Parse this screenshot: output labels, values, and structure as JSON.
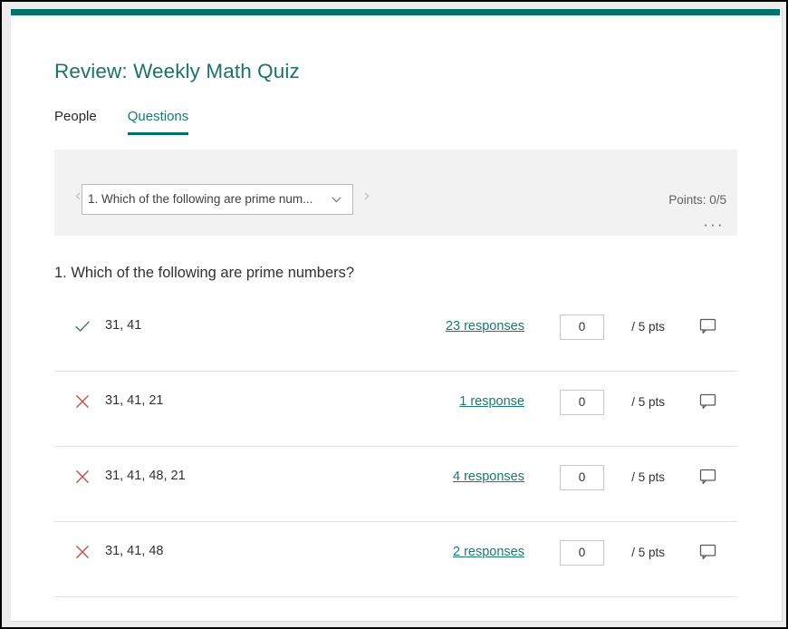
{
  "window": {
    "accent_color": "#00726b"
  },
  "header": {
    "title": "Review: Weekly Math Quiz"
  },
  "tabs": [
    {
      "label": "People",
      "active": false
    },
    {
      "label": "Questions",
      "active": true
    }
  ],
  "question_nav": {
    "prev_icon": "chevron-left-icon",
    "next_icon": "chevron-right-icon",
    "selected_question": "1. Which of the following are prime num...",
    "dropdown_icon": "chevron-down-icon",
    "points_label": "Points: 0/5",
    "more_menu": "···"
  },
  "question": {
    "prompt": "1. Which of the following are prime numbers?",
    "options": [
      {
        "mark": "check-icon",
        "correct": true,
        "text": "31, 41",
        "responses": "23 responses",
        "score": "0",
        "points_suffix": "/ 5 pts",
        "comment_icon": "comment-icon"
      },
      {
        "mark": "cross-icon",
        "correct": false,
        "text": "31, 41, 21",
        "responses": "1 response",
        "score": "0",
        "points_suffix": "/ 5 pts",
        "comment_icon": "comment-icon"
      },
      {
        "mark": "cross-icon",
        "correct": false,
        "text": "31, 41, 48, 21",
        "responses": "4 responses",
        "score": "0",
        "points_suffix": "/ 5 pts",
        "comment_icon": "comment-icon"
      },
      {
        "mark": "cross-icon",
        "correct": false,
        "text": "31, 41, 48",
        "responses": "2 responses",
        "score": "0",
        "points_suffix": "/ 5 pts",
        "comment_icon": "comment-icon"
      }
    ]
  },
  "colors": {
    "accent_teal": "#00726b",
    "title_teal": "#1d7268",
    "link_teal": "#1a7a6e",
    "correct_green": "#3a7d44",
    "incorrect_red": "#c0504d",
    "band_gray": "#f2f2f2"
  }
}
